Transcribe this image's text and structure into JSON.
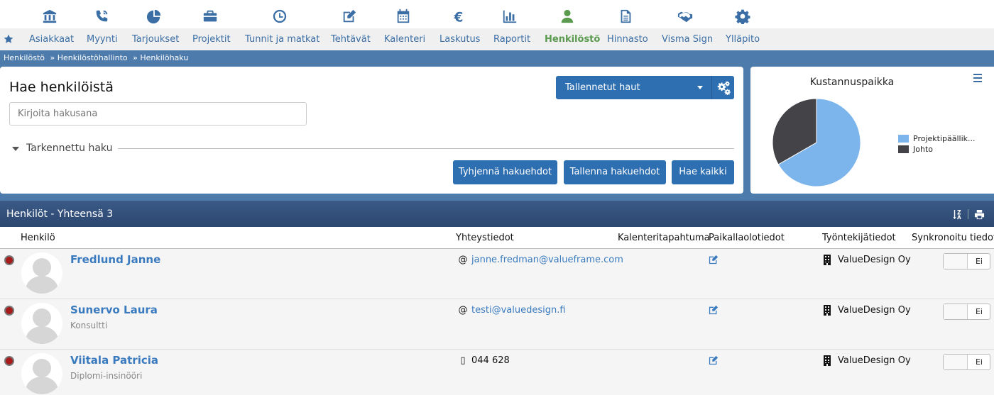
{
  "top_icons": [
    "bank-icon",
    "phone-icon",
    "pie-chart-icon",
    "briefcase-icon",
    "clock-icon",
    "edit-icon",
    "calendar-icon",
    "euro-icon",
    "bar-chart-icon",
    "user-icon",
    "document-icon",
    "handshake-icon",
    "gear-icon"
  ],
  "nav": {
    "items": [
      "Asiakkaat",
      "Myynti",
      "Tarjoukset",
      "Projektit",
      "Tunnit ja matkat",
      "Tehtävät",
      "Kalenteri",
      "Laskutus",
      "Raportit",
      "Henkilöstö",
      "Hinnasto",
      "Visma Sign",
      "Ylläpito"
    ],
    "active": "Henkilöstö",
    "active_color": "#5a9a4f"
  },
  "breadcrumb": [
    "Henkilöstö",
    "» Henkilöstöhallinto",
    "» Henkilöhaku"
  ],
  "search": {
    "title": "Hae henkilöistä",
    "placeholder": "Kirjoita hakusana",
    "saved_searches_label": "Tallennetut haut",
    "advanced_label": "Tarkennettu haku",
    "clear_button": "Tyhjennä hakuehdot",
    "save_button": "Tallenna hakuehdot",
    "search_all_button": "Hae kaikki"
  },
  "chart_data": {
    "type": "pie",
    "title": "Kustannuspaikka",
    "slices": [
      {
        "label": "Projektipäällik...",
        "value": 66.7,
        "color": "#7cb5ec"
      },
      {
        "label": "Johto",
        "value": 33.3,
        "color": "#434348"
      }
    ],
    "legend": "right"
  },
  "list": {
    "title": "Henkilöt - Yhteensä 3",
    "columns": [
      "Henkilö",
      "Yhteystiedot",
      "Kalenteritapahtuma",
      "Paikallaolotiedot",
      "Työntekijätiedot",
      "Synkronoitu tiedot"
    ],
    "rows": [
      {
        "name": "Fredlund Janne",
        "title": "",
        "contact_icon": "@",
        "contact": "janne.fredman@valueframe.com",
        "contact_is_link": true,
        "company": "ValueDesign Oy",
        "sync": "Ei"
      },
      {
        "name": "Sunervo Laura",
        "title": "Konsultti",
        "contact_icon": "@",
        "contact": "testi@valuedesign.fi",
        "contact_is_link": true,
        "company": "ValueDesign Oy",
        "sync": "Ei"
      },
      {
        "name": "Viitala Patricia",
        "title": "Diplomi-insinööri",
        "contact_icon": "▯",
        "contact": "044 628",
        "contact_is_link": false,
        "company": "ValueDesign Oy",
        "sync": "Ei"
      }
    ]
  },
  "colors": {
    "accent": "#2e6fb2",
    "link": "#3a7bbf",
    "status_offline": "#a81b1b"
  }
}
